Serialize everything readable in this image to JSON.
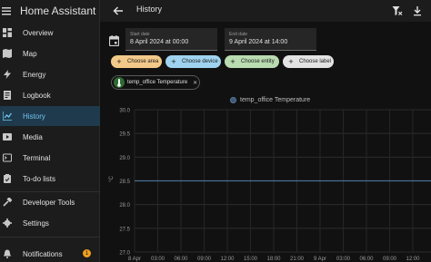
{
  "app": {
    "title": "Home Assistant"
  },
  "sidebar": {
    "items": [
      {
        "label": "Overview",
        "icon": "grid-icon"
      },
      {
        "label": "Map",
        "icon": "map-icon"
      },
      {
        "label": "Energy",
        "icon": "lightning-icon"
      },
      {
        "label": "Logbook",
        "icon": "logbook-icon"
      },
      {
        "label": "History",
        "icon": "chart-icon",
        "active": true
      },
      {
        "label": "Media",
        "icon": "media-icon"
      },
      {
        "label": "Terminal",
        "icon": "terminal-icon"
      },
      {
        "label": "To-do lists",
        "icon": "clipboard-icon"
      },
      {
        "label": "Developer Tools",
        "icon": "hammer-icon"
      },
      {
        "label": "Settings",
        "icon": "gear-icon"
      },
      {
        "label": "Notifications",
        "icon": "bell-icon",
        "badge": "1"
      }
    ]
  },
  "topbar": {
    "title": "History"
  },
  "dates": {
    "start": {
      "caption": "Start date",
      "value": "8 April 2024 at 00:00"
    },
    "end": {
      "caption": "End date",
      "value": "9 April 2024 at 14:00"
    }
  },
  "targets": {
    "choose_area": "Choose area",
    "choose_device": "Choose device",
    "choose_entity": "Choose entity",
    "choose_label": "Choose label",
    "entity": "temp_office Temperature"
  },
  "colors": {
    "accent": "#6fc4f0",
    "area_chip": "#f3c98a",
    "device_chip": "#9fd3ef",
    "entity_chip": "#b9dcb0",
    "label_chip": "#e3e3e3",
    "series": "#4a6f94"
  },
  "chart_data": {
    "type": "line",
    "legend": [
      "temp_office Temperature"
    ],
    "ylabel": "°C",
    "ylim": [
      27.0,
      30.0
    ],
    "yticks": [
      "30.0",
      "29.5",
      "29.0",
      "28.5",
      "28.0",
      "27.5",
      "27.0"
    ],
    "xticks": [
      "8 Apr",
      "03:00",
      "06:00",
      "09:00",
      "12:00",
      "15:00",
      "18:00",
      "21:00",
      "9 Apr",
      "03:00",
      "06:00",
      "09:00",
      "12:00"
    ],
    "series": [
      {
        "name": "temp_office Temperature",
        "x": [
          "8 Apr 00:00",
          "9 Apr 14:00"
        ],
        "y": [
          28.5,
          28.5
        ]
      }
    ]
  }
}
